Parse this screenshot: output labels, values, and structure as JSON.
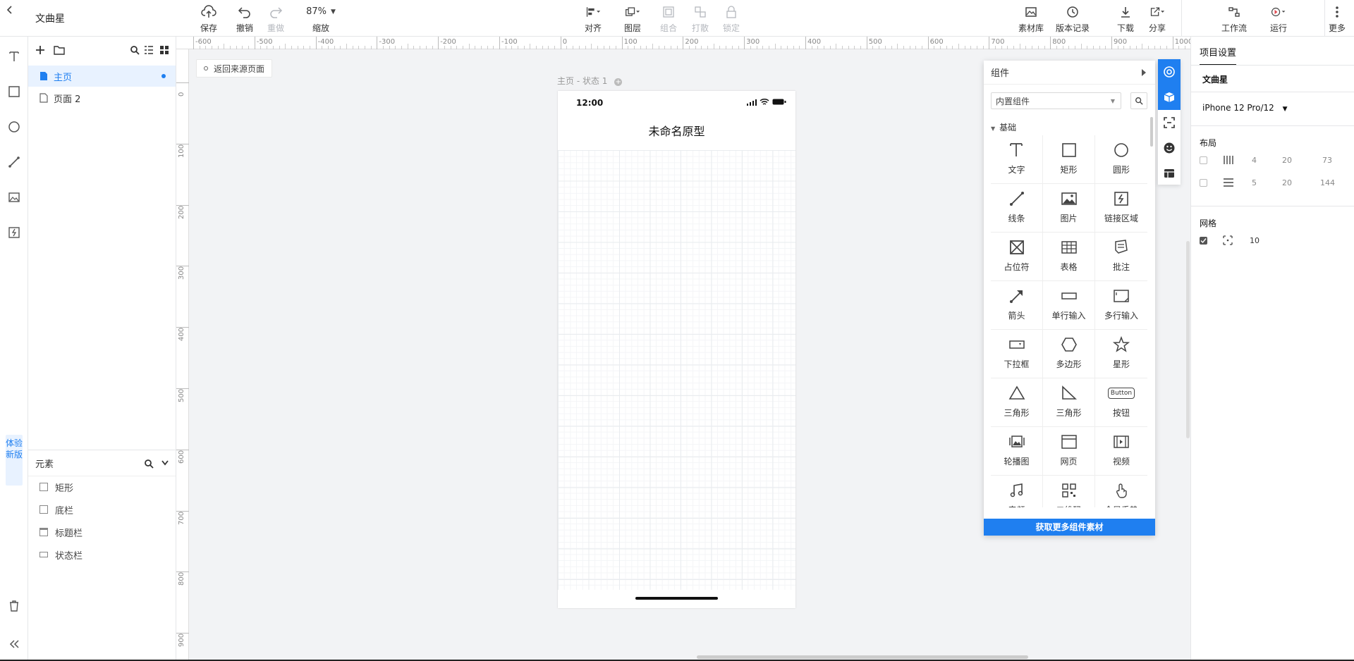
{
  "app": {
    "title": "文曲星"
  },
  "toolbar": {
    "save": "保存",
    "undo": "撤销",
    "redo": "重做",
    "zoom_value": "87%",
    "zoom_label": "缩放",
    "align": "对齐",
    "layer": "图层",
    "group": "组合",
    "ungroup": "打散",
    "lock": "锁定",
    "assets": "素材库",
    "history": "版本记录",
    "download": "下载",
    "share": "分享",
    "workflow": "工作流",
    "run": "运行",
    "more": "更多"
  },
  "left_strip": {
    "try_new": "体验新版"
  },
  "pages": {
    "items": [
      {
        "label": "主页"
      },
      {
        "label": "页面 2"
      }
    ]
  },
  "elements": {
    "title": "元素",
    "items": [
      {
        "label": "矩形"
      },
      {
        "label": "底栏"
      },
      {
        "label": "标题栏"
      },
      {
        "label": "状态栏"
      }
    ]
  },
  "canvas": {
    "back_source": "返回来源页面",
    "state_label": "主页 - 状态 1",
    "ruler_top": [
      "-600",
      "-500",
      "-400",
      "-300",
      "-200",
      "-100",
      "0",
      "100",
      "200",
      "300",
      "400",
      "500",
      "600",
      "700",
      "800",
      "900",
      "1000"
    ],
    "ruler_left": [
      "0",
      "100",
      "200",
      "300",
      "400",
      "500",
      "600",
      "700",
      "800",
      "900"
    ],
    "phone": {
      "time": "12:00",
      "title": "未命名原型"
    }
  },
  "components": {
    "header": "组件",
    "library": "内置组件",
    "category": "基础",
    "items": [
      {
        "label": "文字",
        "icon": "text-icon"
      },
      {
        "label": "矩形",
        "icon": "rect-icon"
      },
      {
        "label": "圆形",
        "icon": "circle-icon"
      },
      {
        "label": "线条",
        "icon": "line-icon"
      },
      {
        "label": "图片",
        "icon": "image-icon"
      },
      {
        "label": "链接区域",
        "icon": "link-area-icon"
      },
      {
        "label": "占位符",
        "icon": "placeholder-icon"
      },
      {
        "label": "表格",
        "icon": "table-icon"
      },
      {
        "label": "批注",
        "icon": "note-icon"
      },
      {
        "label": "箭头",
        "icon": "arrow-icon"
      },
      {
        "label": "单行输入",
        "icon": "input-icon"
      },
      {
        "label": "多行输入",
        "icon": "textarea-icon"
      },
      {
        "label": "下拉框",
        "icon": "select-icon"
      },
      {
        "label": "多边形",
        "icon": "polygon-icon"
      },
      {
        "label": "星形",
        "icon": "star-icon"
      },
      {
        "label": "三角形",
        "icon": "triangle-icon"
      },
      {
        "label": "三角形",
        "icon": "right-triangle-icon"
      },
      {
        "label": "按钮",
        "icon": "button-icon"
      },
      {
        "label": "轮播图",
        "icon": "carousel-icon"
      },
      {
        "label": "网页",
        "icon": "webpage-icon"
      },
      {
        "label": "视频",
        "icon": "video-icon"
      },
      {
        "label": "音频",
        "icon": "audio-icon"
      },
      {
        "label": "二维码",
        "icon": "qrcode-icon"
      },
      {
        "label": "全局手势",
        "icon": "gesture-icon"
      }
    ],
    "button_label": "Button",
    "more": "获取更多组件素材"
  },
  "settings": {
    "tab": "项目设置",
    "project_name": "文曲星",
    "device": "iPhone 12 Pro/12",
    "layout_title": "布局",
    "layout_rows": [
      {
        "a": "4",
        "b": "20",
        "c": "73"
      },
      {
        "a": "5",
        "b": "20",
        "c": "144"
      }
    ],
    "grid_title": "网格",
    "grid_size": "10"
  },
  "colors": {
    "accent": "#1f7ff0"
  }
}
